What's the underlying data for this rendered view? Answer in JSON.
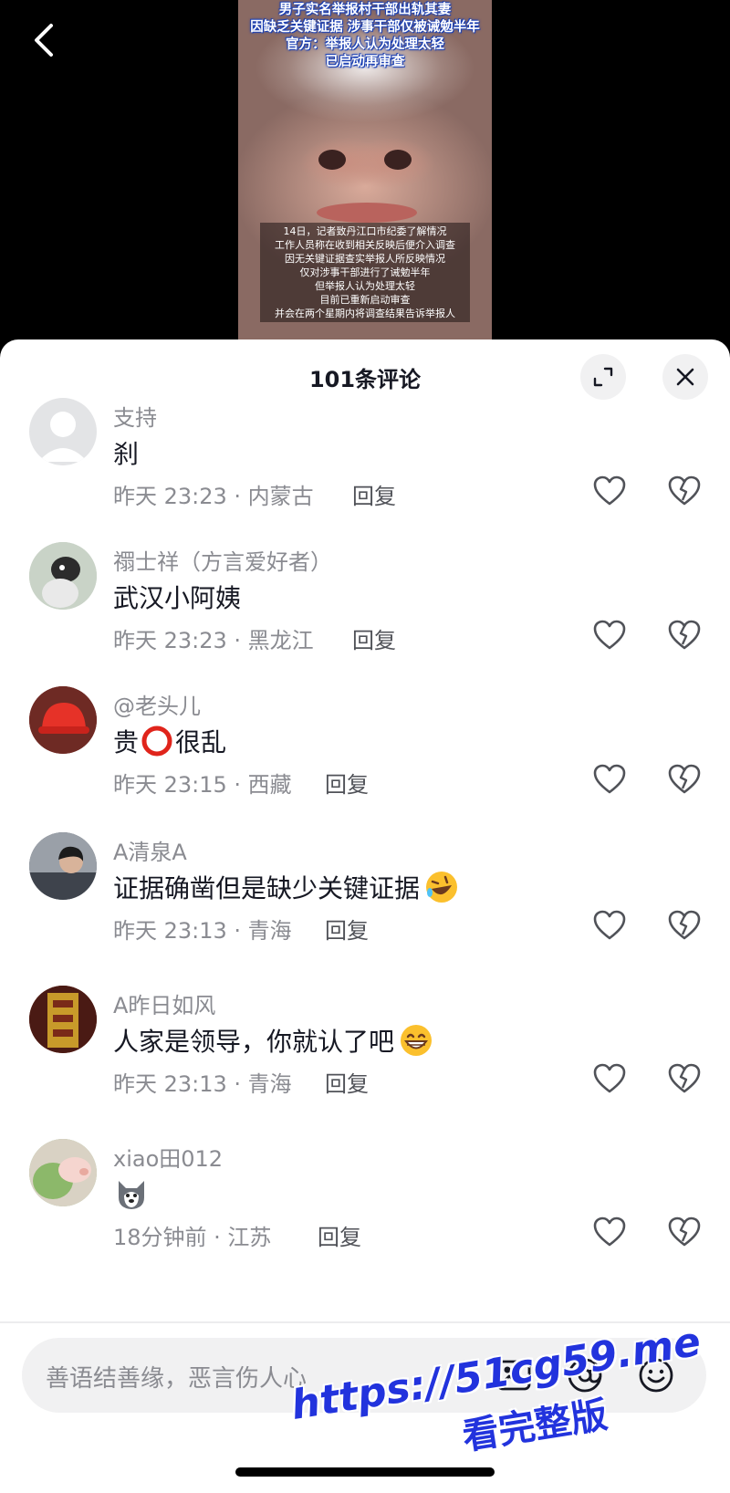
{
  "video": {
    "headline": [
      "男子实名举报村干部出轨其妻",
      "因缺乏关键证据 涉事干部仅被诫勉半年",
      "官方：举报人认为处理太轻",
      "已启动再审查"
    ],
    "caption": [
      "14日，记者致丹江口市纪委了解情况",
      "工作人员称在收到相关反映后便介入调查",
      "因无关键证据查实举报人所反映情况",
      "仅对涉事干部进行了诫勉半年",
      "但举报人认为处理太轻",
      "目前已重新启动审查",
      "并会在两个星期内将调查结果告诉举报人"
    ]
  },
  "sheet": {
    "title": "101条评论"
  },
  "comments": [
    {
      "user": "支持",
      "text": "刹",
      "meta": "昨天 23:23 · 内蒙古",
      "reply": "回复",
      "avatar_color": "#d7d8da"
    },
    {
      "user": "禤士祥（方言爱好者）",
      "text": "武汉小阿姨",
      "meta": "昨天 23:23 · 黑龙江",
      "reply": "回复",
      "avatar_color": "#7a8a78"
    },
    {
      "user": "@老头儿",
      "text": "贵",
      "text2": "很乱",
      "meta": "昨天 23:15 · 西藏",
      "reply": "回复",
      "avatar_color": "#d63b2e"
    },
    {
      "user": "A清泉A",
      "text": "证据确凿但是缺少关键证据",
      "meta": "昨天 23:13 · 青海",
      "reply": "回复",
      "avatar_color": "#5a5f6a"
    },
    {
      "user": "A昨日如风",
      "text": "人家是领导，你就认了吧",
      "meta": "昨天 23:13 · 青海",
      "reply": "回复",
      "avatar_color": "#8a3a22"
    },
    {
      "user": "xiao田012",
      "text": "",
      "meta": "18分钟前 · 江苏",
      "reply": "回复",
      "avatar_color": "#9fc08a"
    }
  ],
  "input": {
    "placeholder": "善语结善缘，恶言伤人心"
  },
  "watermark": {
    "url": "https://51cg59.me",
    "sub": "看完整版"
  }
}
